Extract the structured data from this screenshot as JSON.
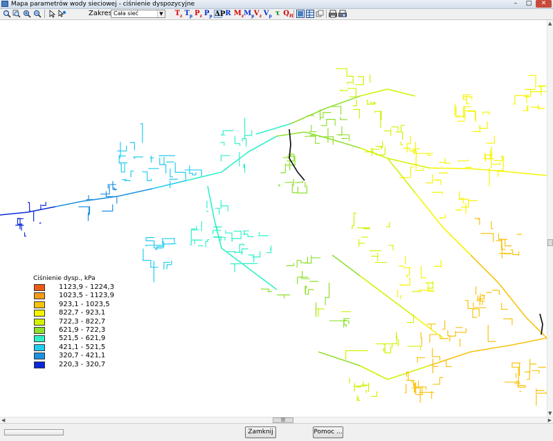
{
  "window": {
    "title": "Mapa parametrów wody sieciowej - ciśnienie dyspozycyjne",
    "minimize": "–",
    "maximize": "□",
    "close": "✕"
  },
  "toolbar": {
    "zoom_tools": [
      "zoom-fit-icon",
      "zoom-window-icon",
      "zoom-in-icon",
      "zoom-out-icon"
    ],
    "pointer_tools": [
      "pointer-icon",
      "pointer-info-icon"
    ],
    "zakres_label": "Zakres :",
    "zakres_value": "Cała sieć",
    "param_tools": [
      {
        "letter": "T",
        "sub": "z",
        "color": "#d60000"
      },
      {
        "letter": "T",
        "sub": "p",
        "color": "#0033cc"
      },
      {
        "letter": "P",
        "sub": "z",
        "color": "#d60000"
      },
      {
        "letter": "P",
        "sub": "p",
        "color": "#0033cc"
      },
      {
        "letter": "ΔP",
        "sub": "",
        "color": "#000000"
      },
      {
        "letter": "R",
        "sub": "",
        "color": "#0033cc"
      },
      {
        "letter": "M",
        "sub": "z",
        "color": "#d60000"
      },
      {
        "letter": "M",
        "sub": "p",
        "color": "#0033cc"
      },
      {
        "letter": "V",
        "sub": "z",
        "color": "#d60000"
      },
      {
        "letter": "V",
        "sub": "p",
        "color": "#0033cc"
      },
      {
        "letter": "τ",
        "sub": "",
        "color": "#008800"
      },
      {
        "letter": "Q",
        "sub": "H",
        "color": "#d60000"
      }
    ],
    "view_tools": [
      "grid-view-icon",
      "table-view-icon",
      "layers-icon"
    ],
    "print_tools": [
      "print-icon",
      "print-preview-icon"
    ]
  },
  "legend": {
    "title": "Ciśnienie dysp., kPa",
    "items": [
      {
        "label": "1123,9 - 1224,3",
        "color": "#ee5a14"
      },
      {
        "label": "1023,5 - 1123,9",
        "color": "#f59b1a"
      },
      {
        "label": "923,1 - 1023,5",
        "color": "#f8c20c"
      },
      {
        "label": "822,7 - 923,1",
        "color": "#f5f500"
      },
      {
        "label": "722,3 - 822,7",
        "color": "#d2f200"
      },
      {
        "label": "621,9 - 722,3",
        "color": "#8ee02c"
      },
      {
        "label": "521,5 - 621,9",
        "color": "#2ef0c8"
      },
      {
        "label": "421,1 - 521,5",
        "color": "#22ccf0"
      },
      {
        "label": "320,7 - 421,1",
        "color": "#1e90e0"
      },
      {
        "label": "220,3 - 320,7",
        "color": "#0a28d8"
      }
    ]
  },
  "buttons": {
    "close": "Zamknij",
    "help": "Pomoc ..."
  },
  "scrollbar_grip": "|||"
}
